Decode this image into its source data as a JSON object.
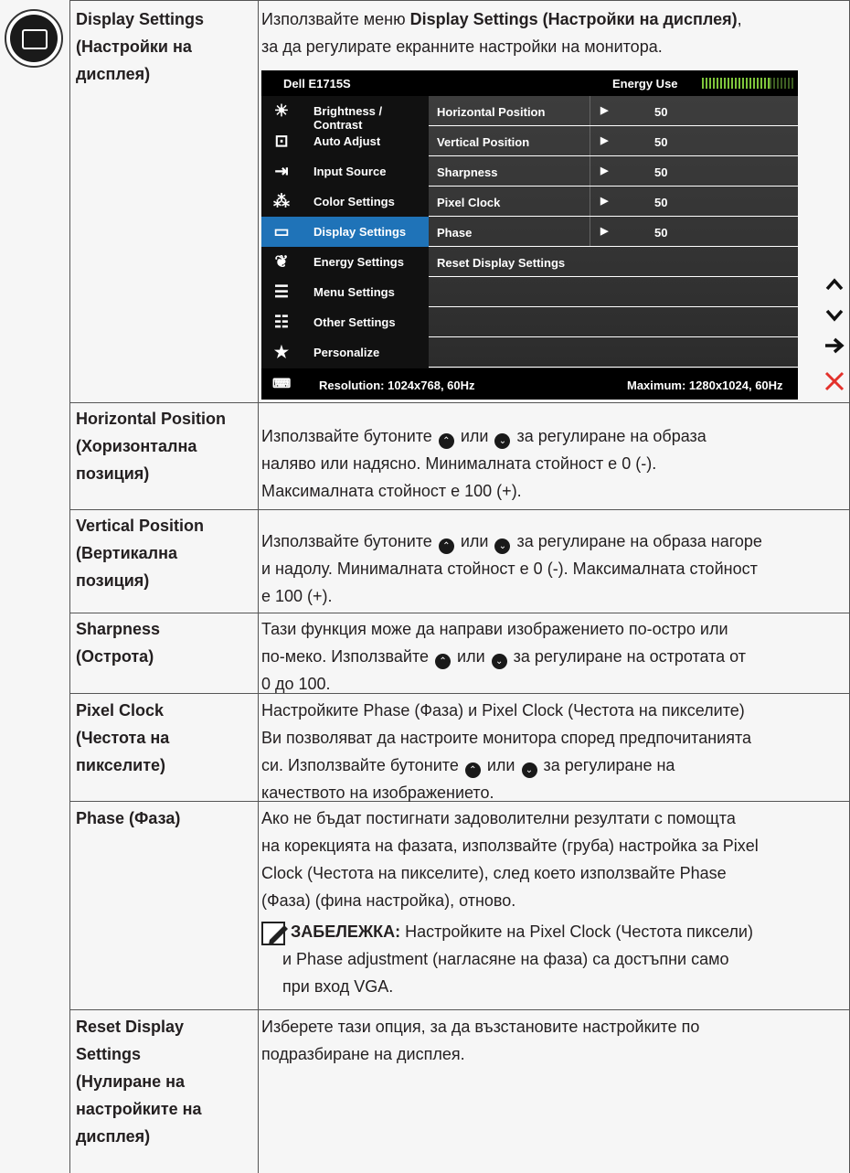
{
  "osd": {
    "model": "Dell E1715S",
    "energy_label": "Energy Use",
    "menu": [
      {
        "label": "Brightness / Contrast",
        "icon": "sun-icon"
      },
      {
        "label": "Auto Adjust",
        "icon": "auto-adjust-icon"
      },
      {
        "label": "Input Source",
        "icon": "input-source-icon"
      },
      {
        "label": "Color Settings",
        "icon": "color-dots-icon"
      },
      {
        "label": "Display Settings",
        "icon": "display-icon"
      },
      {
        "label": "Energy Settings",
        "icon": "leaf-icon"
      },
      {
        "label": "Menu Settings",
        "icon": "menu-icon"
      },
      {
        "label": "Other Settings",
        "icon": "sliders-icon"
      },
      {
        "label": "Personalize",
        "icon": "star-icon"
      }
    ],
    "settings": [
      {
        "label": "Horizontal Position",
        "value": "50"
      },
      {
        "label": "Vertical Position",
        "value": "50"
      },
      {
        "label": "Sharpness",
        "value": "50"
      },
      {
        "label": "Pixel Clock",
        "value": "50"
      },
      {
        "label": "Phase",
        "value": "50"
      },
      {
        "label": "Reset Display Settings",
        "value": ""
      }
    ],
    "resolution": "Resolution: 1024x768, 60Hz",
    "maximum": "Maximum: 1280x1024, 60Hz",
    "arrow_glyph": "▶",
    "side_buttons": [
      "^",
      "v",
      "→",
      "✕"
    ]
  },
  "rows": [
    {
      "label1": "Display Settings",
      "label2": "(Настройки на",
      "label3": "дисплея)",
      "text_a": "Използвайте меню ",
      "text_b": "Display Settings (Настройки на дисплея)",
      "text_c": ",",
      "text_d": "за да регулирате екранните настройки на монитора."
    },
    {
      "label1": "Horizontal Position",
      "label2": "(Хоризонтална",
      "label3": "позиция)",
      "t1": "Използвайте бутоните ",
      "t2": " или ",
      "t3": " за регулиране на образа",
      "t4": "наляво или надясно. Минималната стойност е 0 (-).",
      "t5": "Максималната стойност е 100 (+)."
    },
    {
      "label1": "Vertical Position",
      "label2": "(Вертикална",
      "label3": "позиция)",
      "t1": "Използвайте бутоните ",
      "t2": " или ",
      "t3": " за регулиране на образа нагоре",
      "t4": "и надолу. Минималната стойност е 0 (-). Максималната стойност",
      "t5": "е 100 (+)."
    },
    {
      "label1": "Sharpness",
      "label2": "(Острота)",
      "t1": "Тази функция може да направи изображението по-остро или",
      "t2": "по-меко. Използвайте ",
      "t3": " или ",
      "t4": " за регулиране на остротата от",
      "t5": "0 до 100."
    },
    {
      "label1": "Pixel Clock",
      "label2": "(Честота на",
      "label3": "пикселите)",
      "t1": "Настройките Phase (Фаза) и Pixel Clock (Честота на пикселите)",
      "t2": "Ви позволяват да настроите монитора според предпочитанията",
      "t3": "си. Използвайте бутоните ",
      "t4": " или ",
      "t5": " за регулиране на",
      "t6": "качеството на изображението."
    },
    {
      "label1": "Phase (Фаза)",
      "t1": "Ако не бъдат постигнати задоволителни резултати с помощта",
      "t2": "на корекцията на фазата, използвайте (груба) настройка за Pixel",
      "t3": "Clock (Честота на пикселите), след което използвайте Phase",
      "t4": "(Фаза) (фина настройка), отново.",
      "note_label": "ЗАБЕЛЕЖКА:",
      "note1": " Настройките на Pixel Clock (Честота пиксели)",
      "note2": "и Phase adjustment (нагласяне на фаза) са достъпни само",
      "note3": "при вход VGA."
    },
    {
      "label1": "Reset Display",
      "label2": "Settings",
      "label3": "(Нулиране на",
      "label4": "настройките на",
      "label5": "дисплея)",
      "t1": "Изберете тази опция, за да възстановите настройките по",
      "t2": "подразбиране на дисплея."
    }
  ]
}
